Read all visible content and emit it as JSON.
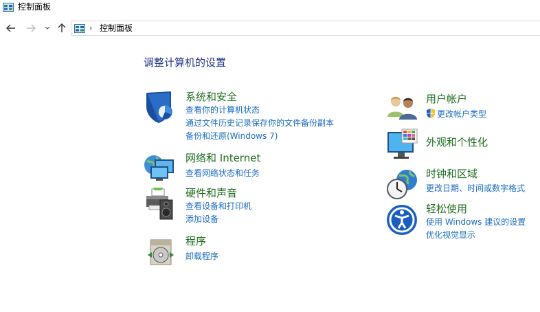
{
  "window": {
    "title": "控制面板"
  },
  "navigation": {
    "back_icon": "arrow-left-icon",
    "forward_icon": "arrow-right-icon",
    "recent_icon": "chevron-down-icon",
    "up_icon": "arrow-up-icon",
    "breadcrumb": [
      "控制面板"
    ]
  },
  "main": {
    "heading": "调整计算机的设置",
    "left_categories": [
      {
        "title": "系统和安全",
        "icon": "shield-icon",
        "links": [
          "查看你的计算机状态",
          "通过文件历史记录保存你的文件备份副本",
          "备份和还原(Windows 7)"
        ]
      },
      {
        "title": "网络和 Internet",
        "icon": "network-globe-icon",
        "links": [
          "查看网络状态和任务"
        ]
      },
      {
        "title": "硬件和声音",
        "icon": "printer-speaker-icon",
        "links": [
          "查看设备和打印机",
          "添加设备"
        ]
      },
      {
        "title": "程序",
        "icon": "programs-disc-icon",
        "links": [
          "卸载程序"
        ]
      }
    ],
    "right_categories": [
      {
        "title": "用户帐户",
        "icon": "users-icon",
        "links": [
          "更改帐户类型"
        ],
        "link_icon": "uac-shield-icon"
      },
      {
        "title": "外观和个性化",
        "icon": "monitor-palette-icon",
        "links": []
      },
      {
        "title": "时钟和区域",
        "icon": "clock-globe-icon",
        "links": [
          "更改日期、时间或数字格式"
        ]
      },
      {
        "title": "轻松使用",
        "icon": "ease-of-access-icon",
        "links": [
          "使用 Windows 建议的设置",
          "优化视觉显示"
        ]
      }
    ]
  },
  "colors": {
    "heading": "#1e3287",
    "category_title": "#1e6e1e",
    "link": "#1b6cc4"
  }
}
